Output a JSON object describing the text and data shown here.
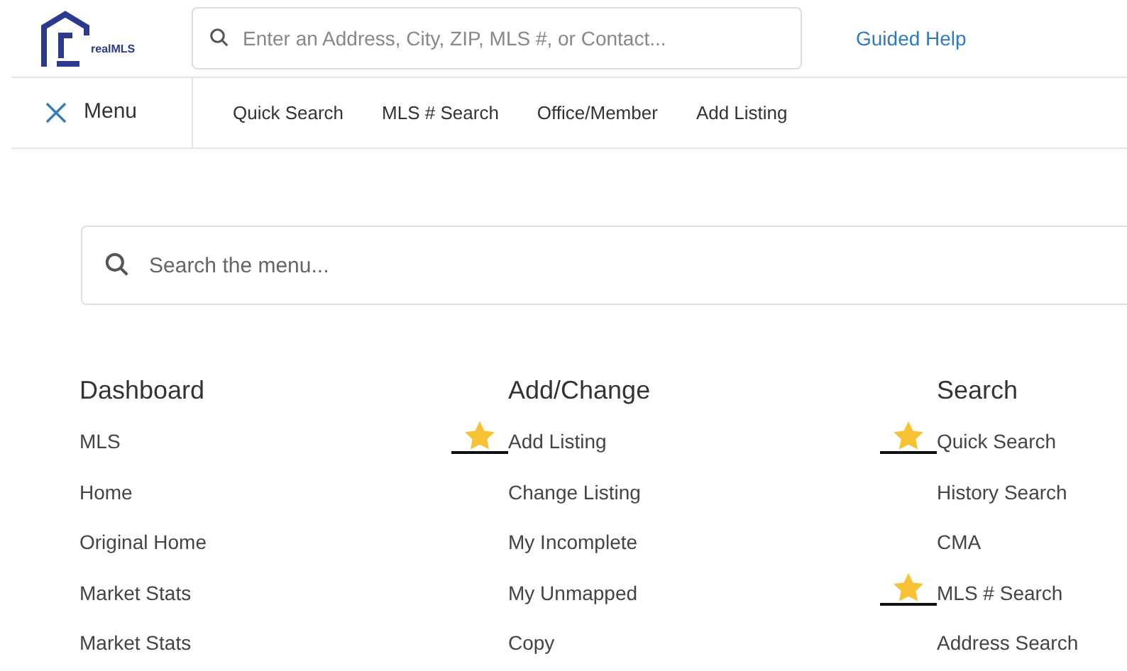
{
  "logo": {
    "text": "realMLS"
  },
  "search": {
    "placeholder": "Enter an Address, City, ZIP, MLS #, or Contact..."
  },
  "guided_help": "Guided Help",
  "menu_button": {
    "label": "Menu",
    "expanded": true
  },
  "nav": [
    "Quick Search",
    "MLS # Search",
    "Office/Member",
    "Add Listing"
  ],
  "menu_search": {
    "placeholder": "Search the menu..."
  },
  "columns": [
    {
      "title": "Dashboard",
      "items": [
        {
          "label": "MLS",
          "favorite": false
        },
        {
          "label": "Home",
          "favorite": false
        },
        {
          "label": "Original Home",
          "favorite": false
        },
        {
          "label": "Market Stats",
          "favorite": false
        },
        {
          "label": "Market Stats",
          "favorite": false
        }
      ]
    },
    {
      "title": "Add/Change",
      "items": [
        {
          "label": "Add Listing",
          "favorite": true
        },
        {
          "label": "Change Listing",
          "favorite": false
        },
        {
          "label": "My Incomplete",
          "favorite": false
        },
        {
          "label": "My Unmapped",
          "favorite": false
        },
        {
          "label": "Copy",
          "favorite": false
        }
      ]
    },
    {
      "title": "Search",
      "items": [
        {
          "label": "Quick Search",
          "favorite": true
        },
        {
          "label": "History Search",
          "favorite": false
        },
        {
          "label": "CMA",
          "favorite": false
        },
        {
          "label": "MLS # Search",
          "favorite": true
        },
        {
          "label": "Address Search",
          "favorite": false
        }
      ]
    }
  ]
}
